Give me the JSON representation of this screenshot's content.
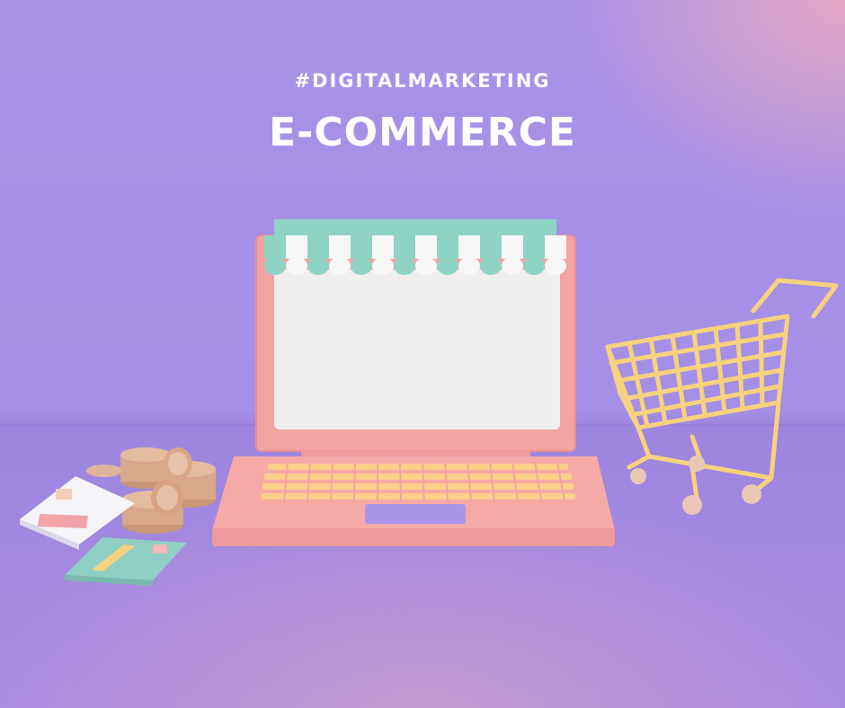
{
  "header": {
    "hashtag": "#DIGITALMARKETING",
    "title": "E-COMMERCE"
  },
  "illustration": {
    "items": [
      "laptop-icon",
      "storefront-awning-icon",
      "shopping-cart-icon",
      "coin-stack-icon",
      "credit-card-icon"
    ]
  },
  "colors": {
    "background": "#a892e8",
    "laptop": "#f4a3a3",
    "screen": "#f0eeee",
    "awning_teal": "#8fd3c4",
    "awning_white": "#f7f7f7",
    "keys": "#f9cf8a",
    "touchpad": "#a996ea",
    "cart": "#f7d27e",
    "coins": "#d9a88a",
    "card_white": "#f5f4f8",
    "card_teal": "#8fcfc4"
  }
}
